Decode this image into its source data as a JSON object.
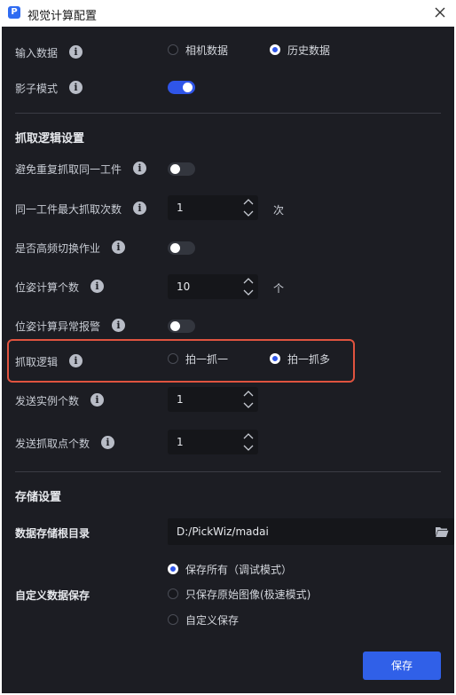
{
  "window": {
    "title": "视觉计算配置",
    "logo_letter": "P"
  },
  "input_data": {
    "label": "输入数据",
    "options": [
      {
        "label": "相机数据",
        "selected": false
      },
      {
        "label": "历史数据",
        "selected": true
      }
    ]
  },
  "shadow_mode": {
    "label": "影子模式",
    "enabled": true
  },
  "grab_logic_section": {
    "title": "抓取逻辑设置"
  },
  "avoid_repeat": {
    "label": "避免重复抓取同一工件",
    "enabled": false
  },
  "max_grab": {
    "label": "同一工件最大抓取次数",
    "value": "1",
    "unit": "次"
  },
  "frequent_switch": {
    "label": "是否高频切换作业",
    "enabled": false
  },
  "pose_count": {
    "label": "位姿计算个数",
    "value": "10",
    "unit": "个"
  },
  "pose_alarm": {
    "label": "位姿计算异常报警",
    "enabled": false
  },
  "grab_logic": {
    "label": "抓取逻辑",
    "options": [
      {
        "label": "拍一抓一",
        "selected": false
      },
      {
        "label": "拍一抓多",
        "selected": true
      }
    ]
  },
  "send_instances": {
    "label": "发送实例个数",
    "value": "1"
  },
  "send_points": {
    "label": "发送抓取点个数",
    "value": "1"
  },
  "storage_section": {
    "title": "存储设置"
  },
  "storage_root": {
    "label": "数据存储根目录",
    "value": "D:/PickWiz/madai"
  },
  "custom_save": {
    "label": "自定义数据保存",
    "options": [
      {
        "label": "保存所有（调试模式）",
        "selected": true
      },
      {
        "label": "只保存原始图像(极速模式)",
        "selected": false
      },
      {
        "label": "自定义保存",
        "selected": false
      }
    ]
  },
  "save_button": {
    "label": "保存"
  },
  "colors": {
    "accent": "#2f55e8",
    "highlight": "#e0533f",
    "background": "#1c1d23"
  }
}
